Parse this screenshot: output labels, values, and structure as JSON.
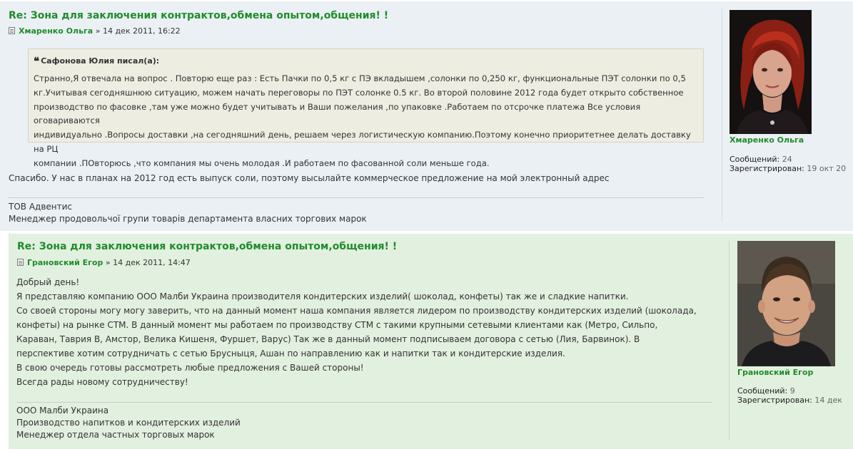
{
  "posts": [
    {
      "title": "Re: Зона для заключения контрактов,обмена опытом,общения! !",
      "author": "Хмаренко Ольга",
      "date_sep": "»",
      "date": "14 дек 2011, 16:22",
      "quote": {
        "author_line": "Сафонова Юлия писал(а):",
        "lines": [
          "Странно,Я отвечала на вопрос . Повторю еще раз : Есть Пачки по 0,5 кг с ПЭ вкладышем ,солонки по 0,250 кг, функциональные ПЭТ солонки по 0,5",
          "кг.Учитывая сегодняшнюю ситуацию, можем начать переговоры по ПЭТ солонке 0.5 кг. Во второй половине 2012 года будет открыто собственное",
          "производство по фасовке ,там уже можно будет учитывать и Ваши пожелания ,по упаковке .Работаем по отсрочке платежа Все условия оговариваются",
          "индивидуально .Вопросы доставки ,на сегодняшний день, решаем через логистическую компанию.Поэтому конечно приоритетнее делать доставку на РЦ",
          "компании .ПОвторюсь ,что компания мы очень молодая .И работаем по фасованной соли меньше года."
        ]
      },
      "body": [
        "Спасибо. У нас в планах на 2012 год есть выпуск соли, поэтому высылайте коммерческое предложение на мой электронный адрес"
      ],
      "signature": [
        "ТОВ Адвентис",
        "Менеджер продовольчої групи товарів департамента власних торгових марок"
      ],
      "profile": {
        "name": "Хмаренко Ольга",
        "posts_label": "Сообщений:",
        "posts_value": "24",
        "registered_label": "Зарегистрирован:",
        "registered_value": "19 окт 20"
      }
    },
    {
      "title": "Re: Зона для заключения контрактов,обмена опытом,общения! !",
      "author": "Грановский Егор",
      "date_sep": "»",
      "date": "14 дек 2011, 14:47",
      "body": [
        "Добрый день!",
        "Я представляю компанию ООО Малби Украина производителя кондитерских изделий( шоколад, конфеты) так же и сладкие напитки.",
        "Со своей стороны могу могу заверить, что на данный момент наша компания является лидером по производству кондитерских изделий (шоколада,",
        "конфеты) на рынке СТМ. В данный момент мы работаем по производству СТМ с такими крупными сетевыми клиентами как (Метро, Сильпо,",
        "Караван, Таврия В, Амстор, Велика Кишеня, Фуршет, Варус) Так же в данный момент подписываем договора с сетью (Лия, Барвинок). В",
        "перспективе хотим сотрудничать с сетью Брусныця, Ашан по направлению как и напитки так и кондитерские изделия.",
        "В свою очередь готовы рассмотреть любые предложения с Вашей стороны!",
        "Всегда рады новому сотрудничеству!"
      ],
      "signature": [
        "ООО Малби Украина",
        "Производство напитков и кондитерских изделий",
        "Менеджер отдела частных торговых марок"
      ],
      "profile": {
        "name": "Грановский Егор",
        "posts_label": "Сообщений:",
        "posts_value": "9",
        "registered_label": "Зарегистрирован:",
        "registered_value": "14 дек"
      }
    }
  ]
}
